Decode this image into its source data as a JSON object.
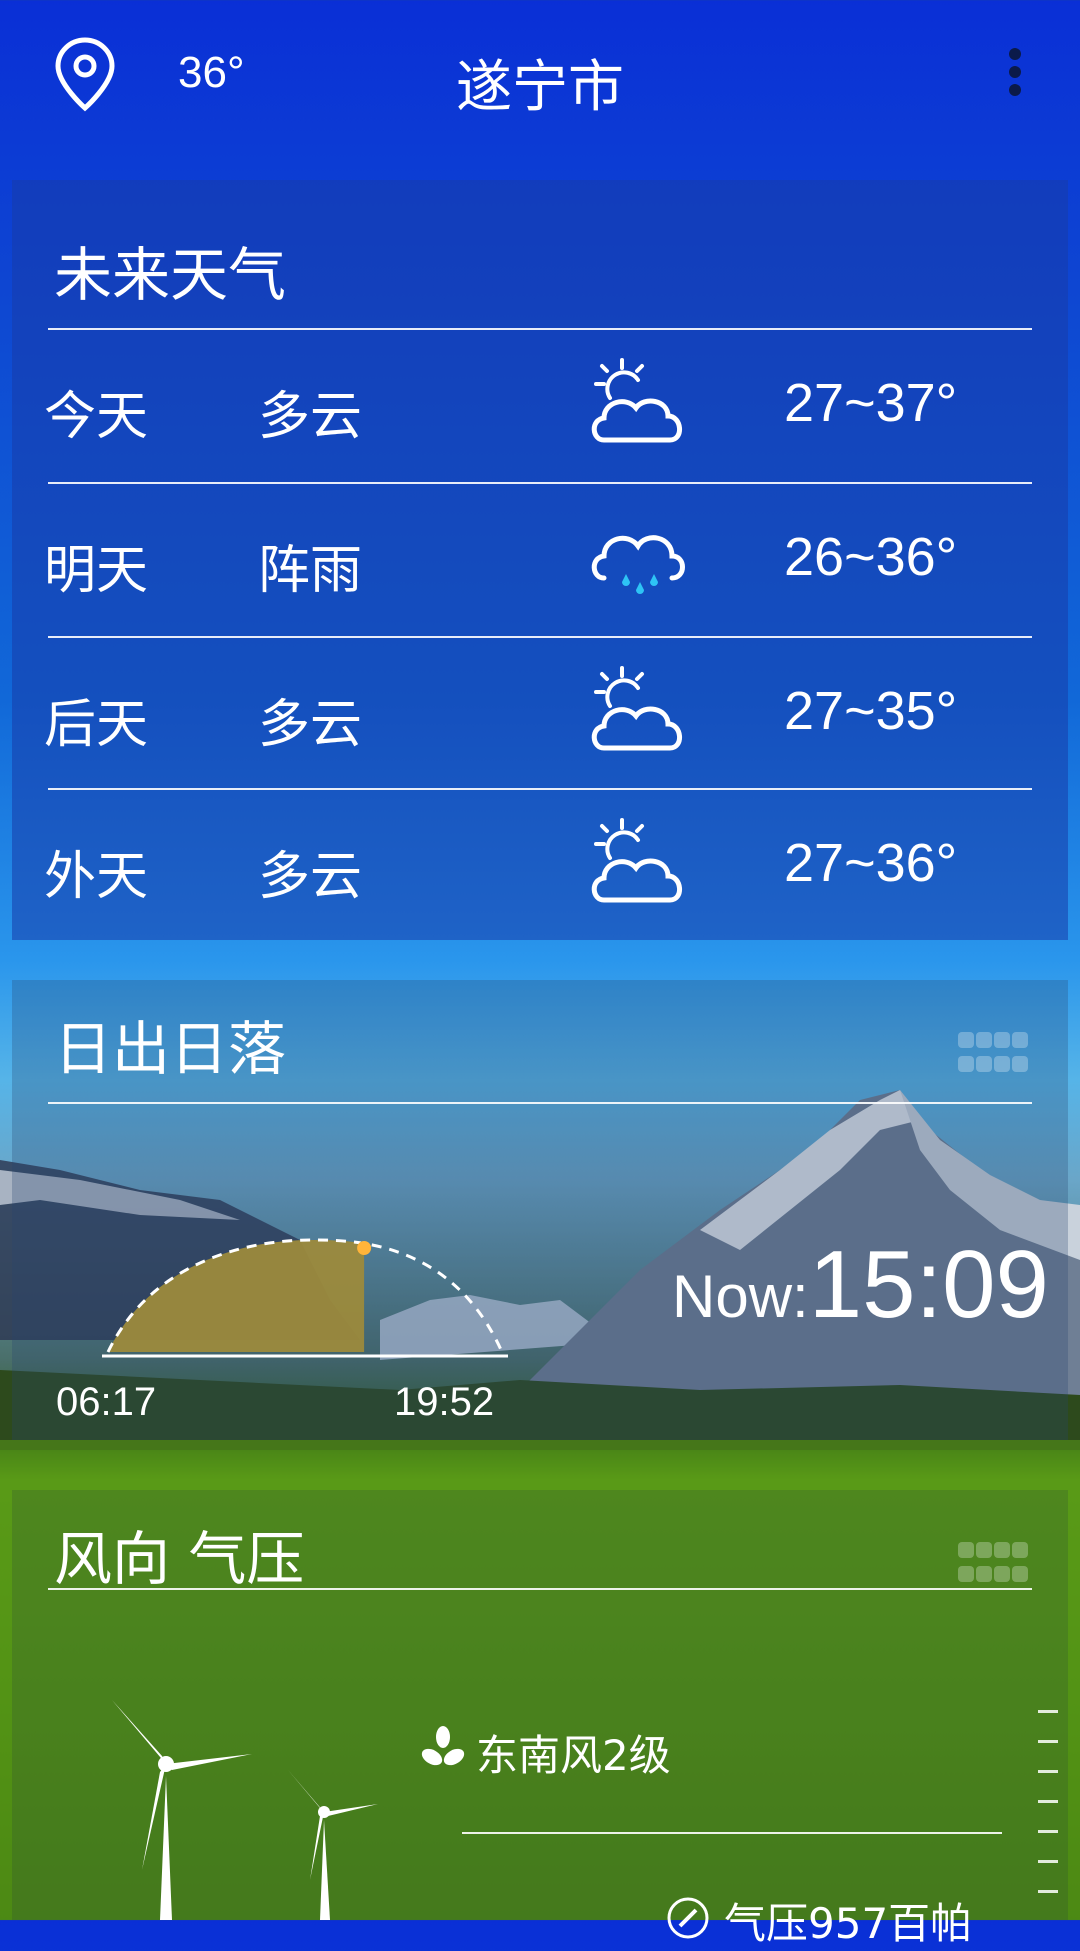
{
  "header": {
    "current_temp": "36°",
    "city": "遂宁市",
    "location_icon": "location-pin-icon",
    "menu_icon": "more-vertical-icon"
  },
  "forecast": {
    "title": "未来天气",
    "rows": [
      {
        "day": "今天",
        "condition": "多云",
        "icon": "partly-cloudy-icon",
        "range": "27~37°"
      },
      {
        "day": "明天",
        "condition": "阵雨",
        "icon": "shower-icon",
        "range": "26~36°"
      },
      {
        "day": "后天",
        "condition": "多云",
        "icon": "partly-cloudy-icon",
        "range": "27~35°"
      },
      {
        "day": "外天",
        "condition": "多云",
        "icon": "partly-cloudy-icon",
        "range": "27~36°"
      }
    ]
  },
  "sun": {
    "title": "日出日落",
    "sunrise": "06:17",
    "sunset": "19:52",
    "now_label": "Now:",
    "now_time": "15:09",
    "progress": 0.65
  },
  "wind": {
    "title": "风向 气压",
    "direction": "东南风2级",
    "pressure": "气压957百帕"
  },
  "colors": {
    "sun_fill": "#9c8a3c",
    "rain_drop": "#2ec3f5",
    "accent_dot": "#ffb43a"
  }
}
